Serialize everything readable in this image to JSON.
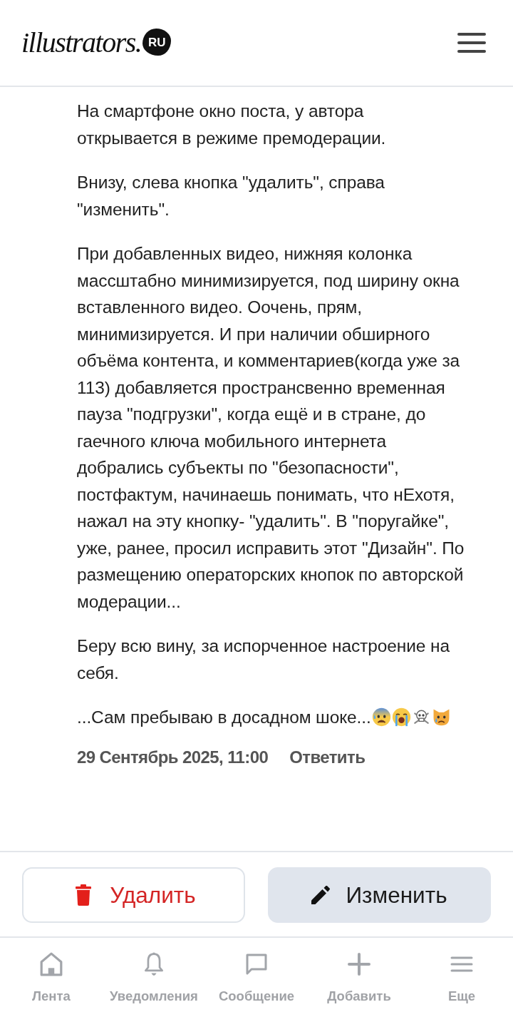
{
  "header": {
    "logo": {
      "text": "illustrators.",
      "badge": "RU"
    }
  },
  "post": {
    "paragraphs": [
      "На смартфоне окно поста, у автора открывается в режиме премодерации.",
      "Внизу, слева кнопка \"удалить\", справа \"изменить\".",
      "При добавленных видео, нижняя колонка массштабно минимизируется, под ширину окна вставленного видео. Оочень, прям, минимизируется. И при наличии обширного объёма контента, и комментариев(когда уже за 113) добавляется пространсвенно временная пауза \"подгрузки\", когда ещё и в стране, до гаечного ключа мобильного интернета добрались субъекты по \"безопасности\", постфактум, начинаешь понимать, что нЕхотя, нажал на эту кнопку- \"удалить\". В \"поругайке\", уже, ранее, просил исправить этот \"Дизайн\". По размещению операторских кнопок по авторской модерации...",
      "Беру всю вину, за испорченное настроение на себя.",
      "...Сам пребываю в досадном шоке..."
    ],
    "date": "29 Сентябрь 2025, 11:00",
    "reply": "Ответить"
  },
  "actions": [
    {
      "kind": "delete",
      "label": "Удалить"
    },
    {
      "kind": "edit",
      "label": "Изменить"
    }
  ],
  "nav": [
    {
      "kind": "home",
      "label": "Лента"
    },
    {
      "kind": "bell",
      "label": "Уведомления"
    },
    {
      "kind": "chat",
      "label": "Сообщение"
    },
    {
      "kind": "plus",
      "label": "Добавить"
    },
    {
      "kind": "menu",
      "label": "Еще"
    }
  ]
}
